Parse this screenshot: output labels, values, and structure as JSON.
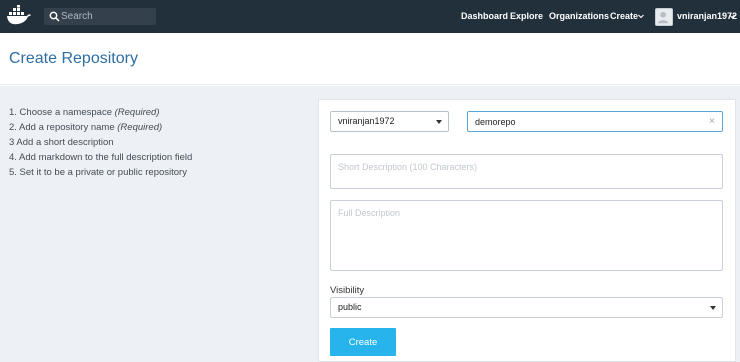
{
  "search": {
    "placeholder": "Search"
  },
  "nav": {
    "dashboard": "Dashboard",
    "explore": "Explore",
    "organizations": "Organizations",
    "create": "Create",
    "username": "vniranjan1972"
  },
  "page": {
    "title": "Create Repository"
  },
  "steps": [
    {
      "text": "1.  Choose a namespace ",
      "note": "(Required)"
    },
    {
      "text": "2.  Add a repository name ",
      "note": "(Required)"
    },
    {
      "text": "3   Add a short description",
      "note": ""
    },
    {
      "text": "4.  Add markdown to the full description field",
      "note": ""
    },
    {
      "text": "5.  Set it to be a private or public repository",
      "note": ""
    }
  ],
  "form": {
    "namespace": "vniranjan1972",
    "repo_name": "demorepo",
    "short_description_placeholder": "Short Description (100 Characters)",
    "full_description_placeholder": "Full Description",
    "visibility_label": "Visibility",
    "visibility_value": "public",
    "create_label": "Create"
  },
  "colors": {
    "nav_bg": "#22303c",
    "title": "#2d6ea3",
    "content_bg": "#edf1f6",
    "button": "#27b4ed",
    "input_focus_border": "#5aa7d6"
  },
  "icons": [
    "docker-whale-logo-icon",
    "search-icon",
    "chevron-down-icon",
    "avatar-icon",
    "close-icon"
  ]
}
